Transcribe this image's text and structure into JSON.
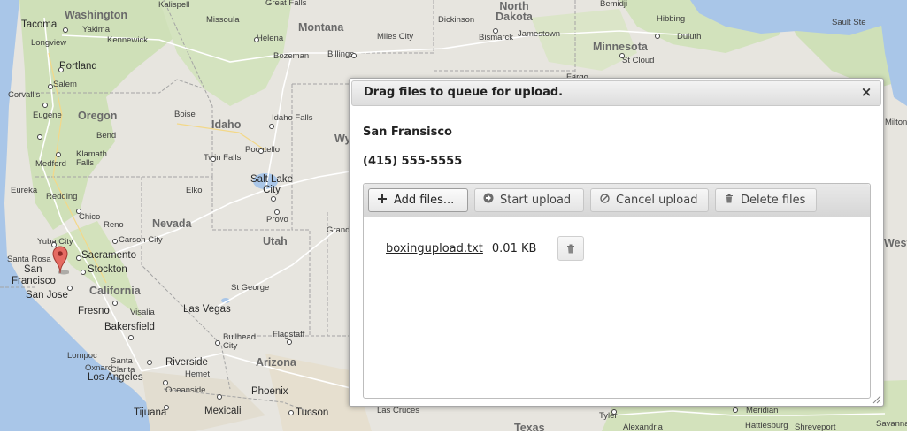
{
  "map": {
    "marker_location": "San Francisco",
    "state_labels": [
      "Washington",
      "Oregon",
      "Idaho",
      "Montana",
      "Nevada",
      "Utah",
      "California",
      "Arizona",
      "North Dakota",
      "Minnesota",
      "Wy"
    ],
    "city_labels": [
      "Tacoma",
      "Yakima",
      "Kennewick",
      "Longview",
      "Portland",
      "Salem",
      "Corvallis",
      "Eugene",
      "Bend",
      "Medford",
      "Klamath Falls",
      "Redding",
      "Eureka",
      "Chico",
      "Yuba City",
      "Santa Rosa",
      "San",
      "Francisco",
      "San Jose",
      "Sacramento",
      "Stockton",
      "Carson City",
      "Reno",
      "Fresno",
      "Visalia",
      "Bakersfield",
      "Lompoc",
      "Santa Clarita",
      "Los Angeles",
      "Oxnard",
      "Riverside",
      "Hemet",
      "Oceanside",
      "Tijuana",
      "Mexicali",
      "Las Vegas",
      "St George",
      "Bullhead City",
      "Flagstaff",
      "Phoenix",
      "Tucson",
      "Las Cruces",
      "Boise",
      "Twin Falls",
      "Pocatello",
      "Idaho Falls",
      "Missoula",
      "Helena",
      "Great Falls",
      "Bozeman",
      "Billings",
      "Miles City",
      "Dickinson",
      "Bismarck",
      "Jamestown",
      "St Cloud",
      "Hibbing",
      "Duluth",
      "Elko",
      "Salt Lake City",
      "Provo",
      "Tyler",
      "Meridian",
      "Hattiesburg",
      "Savanna",
      "Alexandria",
      "Shreveport",
      "Texas",
      "Milton",
      "Sault Ste",
      "West",
      "Bemidji",
      "Fargo",
      "Grand",
      "Kalispell"
    ],
    "colors": {
      "land": "#e6e4df",
      "green": "#cfe0b8",
      "water": "#a8c6e8",
      "border": "#9b9b9b",
      "road": "#ffffff"
    }
  },
  "dialog": {
    "title": "Drag files to queue for upload.",
    "close_symbol": "×",
    "location_name": "San Fransisco",
    "phone": "(415) 555-5555",
    "toolbar": {
      "add_label": "Add files...",
      "start_label": "Start upload",
      "cancel_label": "Cancel upload",
      "delete_label": "Delete files"
    },
    "files": [
      {
        "name": "boxingupload.txt",
        "size": "0.01 KB"
      }
    ]
  },
  "icons": {
    "add": "plus-icon",
    "start": "circle-arrow-right-icon",
    "cancel": "ban-icon",
    "delete": "trash-icon",
    "close": "close-icon",
    "marker": "map-pin-icon"
  }
}
